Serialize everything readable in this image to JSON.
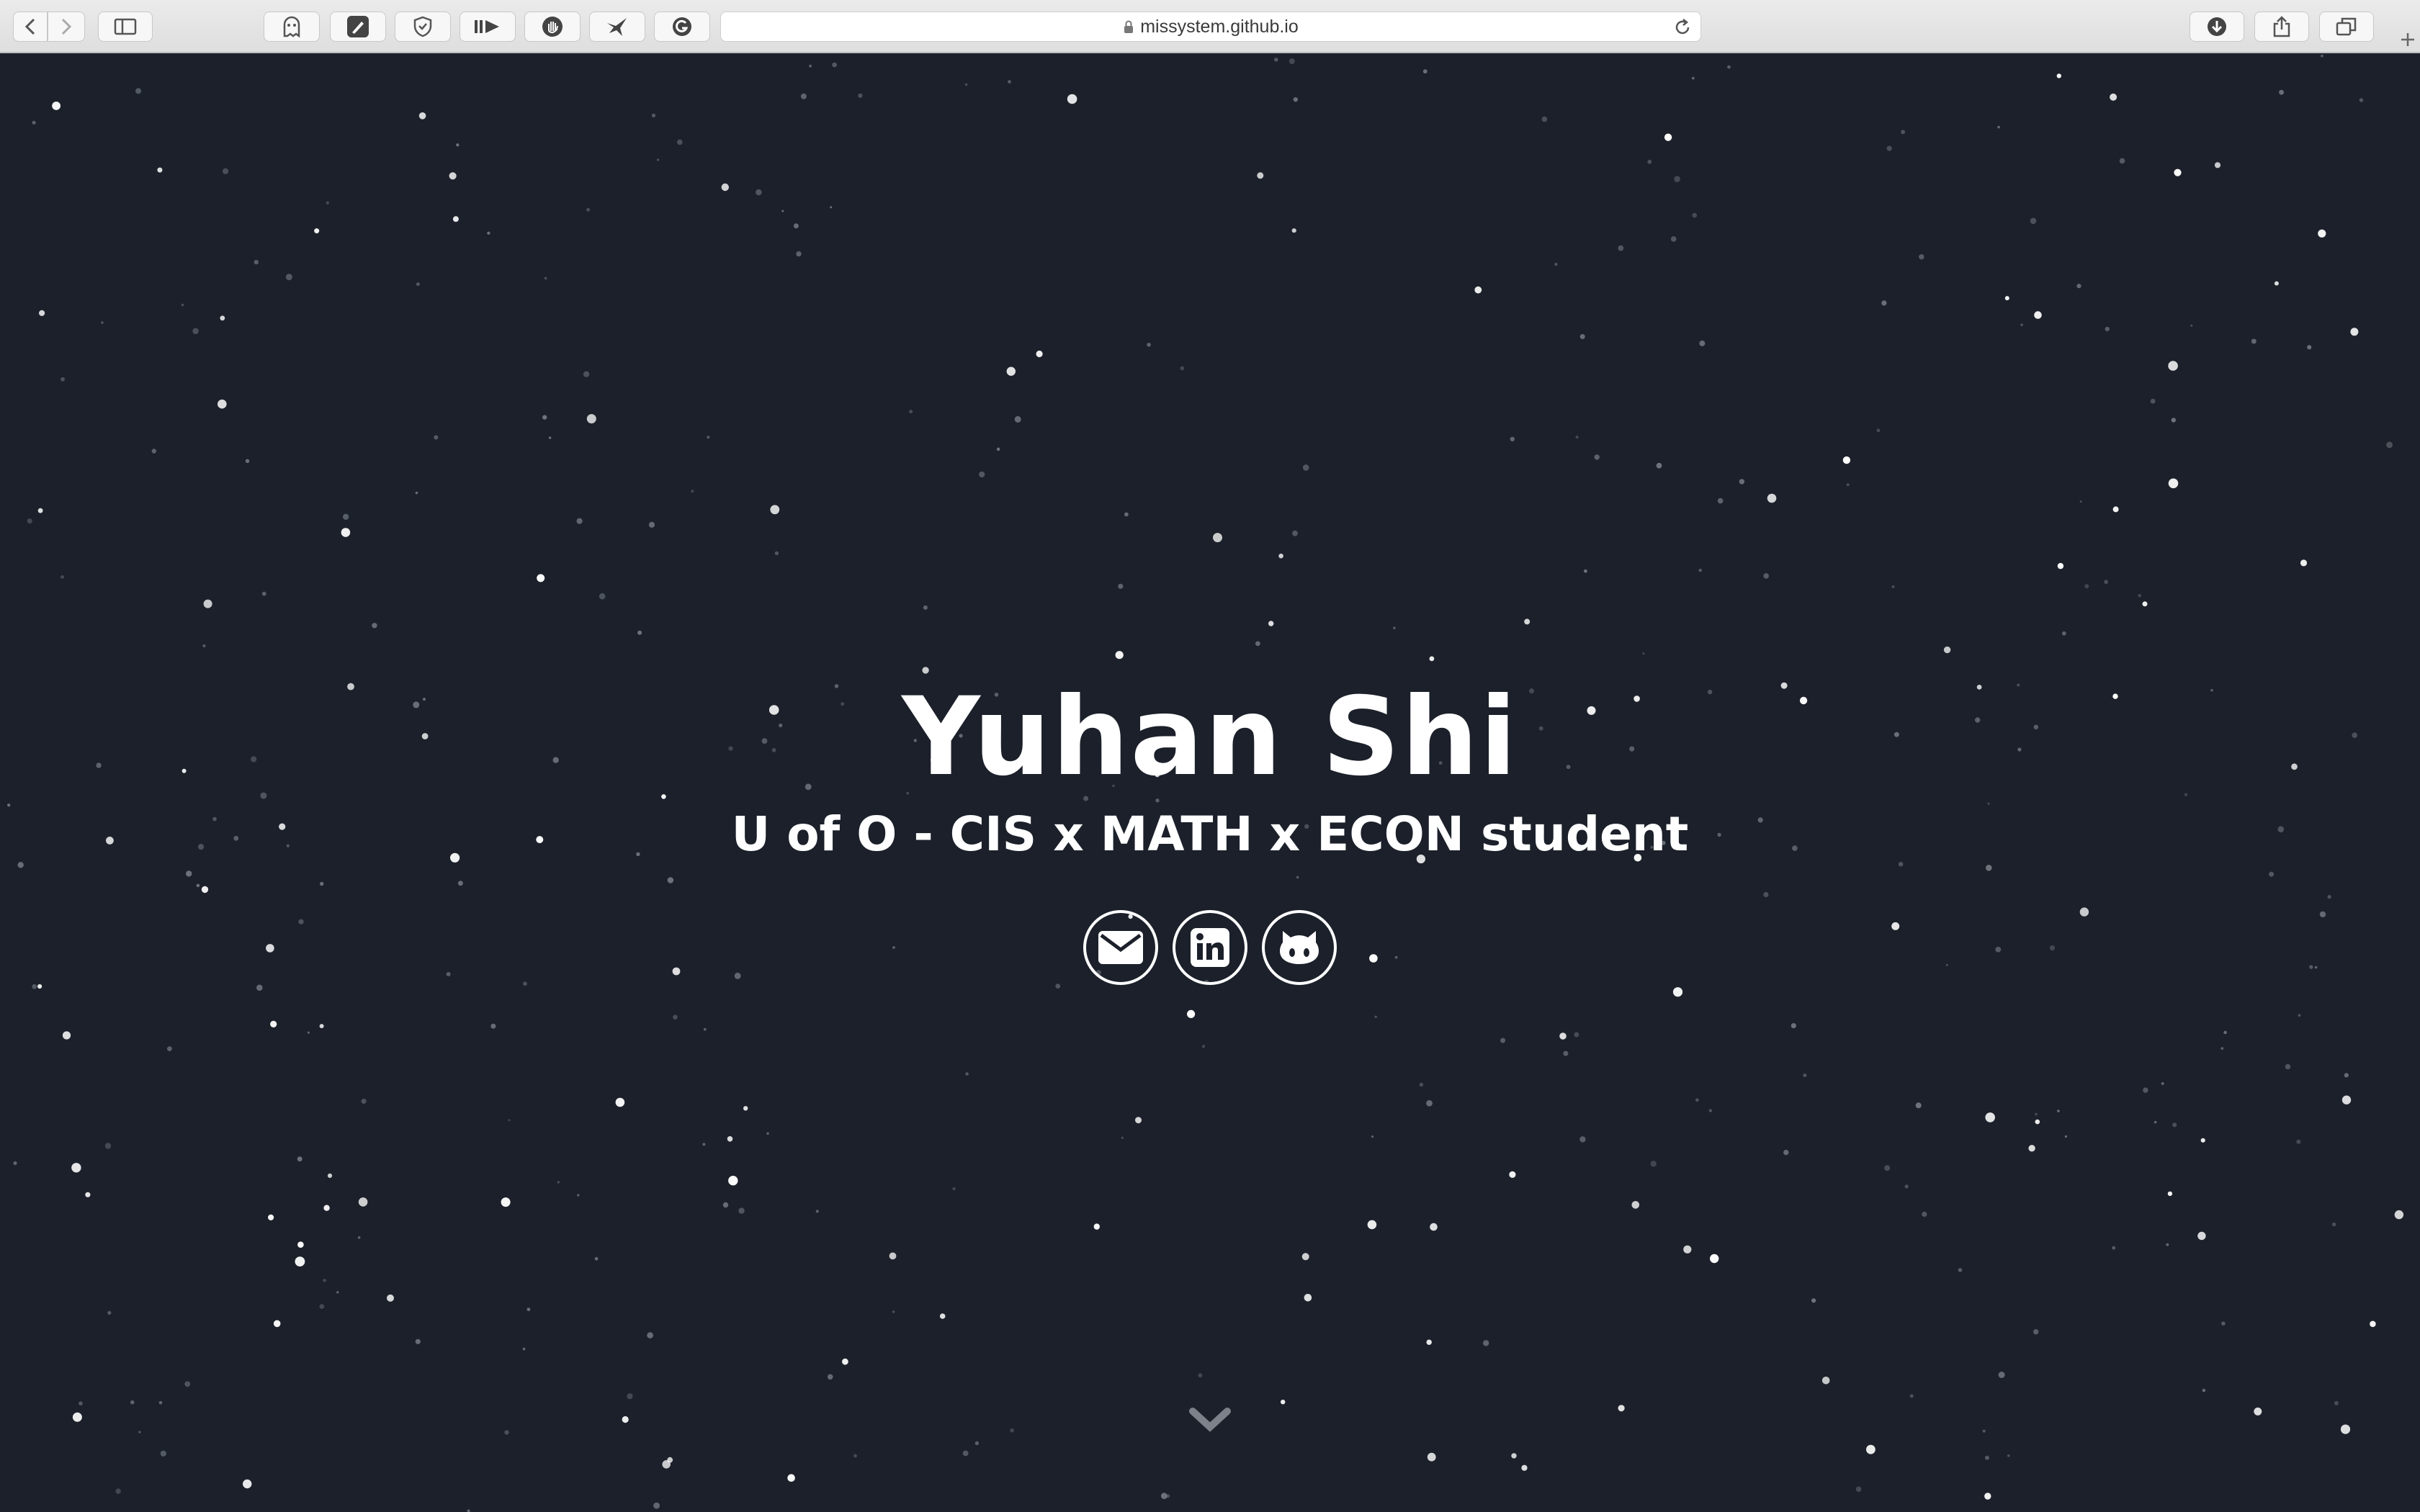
{
  "browser": {
    "url": "missystem.github.io",
    "buttons": {
      "back": "back",
      "forward": "forward",
      "sidebar": "sidebar",
      "downloads": "downloads",
      "share": "share",
      "tabs": "tab-overview",
      "new_tab": "new-tab"
    },
    "extensions": [
      "ghostery-extension",
      "pen-extension",
      "shield-extension",
      "play-next-extension",
      "hand-extension",
      "bird-extension",
      "grammarly-extension"
    ]
  },
  "hero": {
    "name": "Yuhan Shi",
    "subtitle": "U of O - CIS x MATH x ECON student",
    "socials": [
      {
        "icon": "envelope-icon",
        "label": "email"
      },
      {
        "icon": "linkedin-icon",
        "label": "linkedin"
      },
      {
        "icon": "github-icon",
        "label": "github"
      }
    ],
    "scroll_hint": "chevron-down"
  },
  "colors": {
    "background": "#1b202a",
    "text": "#ffffff",
    "star": "#ffffff",
    "star_dim": "#8a8f99",
    "toolbar": "#e4e4e4"
  }
}
